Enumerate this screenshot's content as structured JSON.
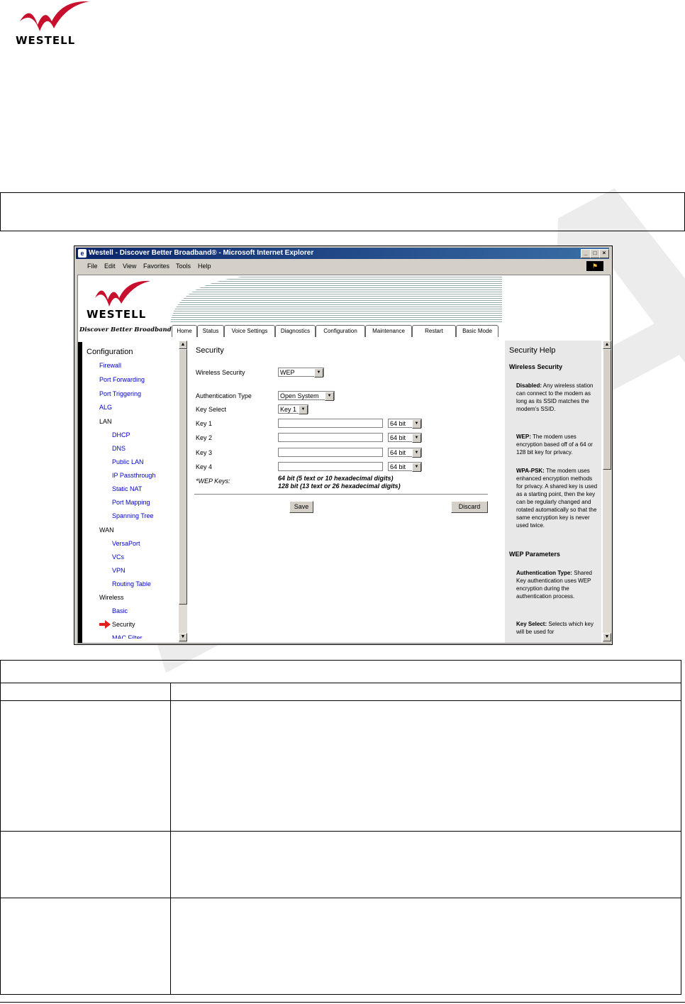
{
  "document": {
    "logo_text": "WESTELL"
  },
  "browser": {
    "title": "Westell - Discover Better Broadband® - Microsoft Internet Explorer",
    "menu": [
      "File",
      "Edit",
      "View",
      "Favorites",
      "Tools",
      "Help"
    ]
  },
  "router": {
    "logo_text": "WESTELL",
    "tagline": "Discover Better Broadband",
    "tabs": [
      "Home",
      "Status",
      "Voice Settings",
      "Diagnostics",
      "Configuration",
      "Maintenance",
      "Restart",
      "Basic Mode"
    ]
  },
  "sidebar": {
    "heading": "Configuration",
    "items": [
      "Firewall",
      "Port Forwarding",
      "Port Triggering",
      "ALG",
      "LAN",
      "DHCP",
      "DNS",
      "Public LAN",
      "IP Passthrough",
      "Static NAT",
      "Port Mapping",
      "Spanning Tree",
      "WAN",
      "VersaPort",
      "VCs",
      "VPN",
      "Routing Table",
      "Wireless",
      "Basic",
      "Security",
      "MAC Filter"
    ]
  },
  "form": {
    "title": "Security",
    "wireless_security_label": "Wireless Security",
    "wireless_security_value": "WEP",
    "auth_type_label": "Authentication Type",
    "auth_type_value": "Open System",
    "key_select_label": "Key Select",
    "key_select_value": "Key 1",
    "keys": [
      {
        "label": "Key 1",
        "value": "",
        "size": "64 bit"
      },
      {
        "label": "Key 2",
        "value": "",
        "size": "64 bit"
      },
      {
        "label": "Key 3",
        "value": "",
        "size": "64 bit"
      },
      {
        "label": "Key 4",
        "value": "",
        "size": "64 bit"
      }
    ],
    "wep_keys_label": "*WEP Keys:",
    "wep_note_1": "64 bit (5 text or 10 hexadecimal digits)",
    "wep_note_2": "128 bit (13 text or 26 hexadecimal digits)",
    "save_label": "Save",
    "discard_label": "Discard"
  },
  "help": {
    "title": "Security Help",
    "section1": "Wireless Security",
    "disabled_term": "Disabled:",
    "disabled_text": "Any wireless station can connect to the modem as long as its SSID matches the modem's SSID.",
    "wep_term": "WEP:",
    "wep_text": "The modem uses encryption based off of a 64 or 128 bit key for privacy.",
    "wpa_term": "WPA-PSK:",
    "wpa_text": "The modem uses enhanced encryption methods for privacy. A shared key is used as a starting point, then the key can be regularly changed and rotated automatically so that the same encryption key is never used twice.",
    "section2": "WEP Parameters",
    "auth_term": "Authentication Type:",
    "auth_text": "Shared Key authentication uses WEP encryption during the authentication process.",
    "keysel_term": "Key Select:",
    "keysel_text": "Selects which key will be used for"
  }
}
